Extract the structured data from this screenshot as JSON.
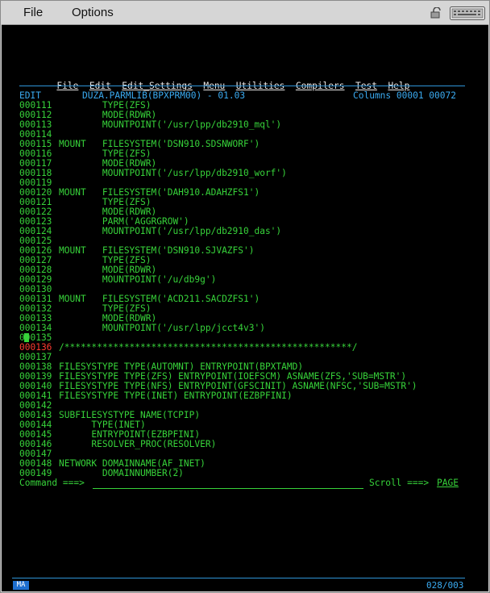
{
  "menubar": {
    "file": "File",
    "options": "Options"
  },
  "panel": {
    "menu": [
      "File",
      "Edit",
      "Edit_Settings",
      "Menu",
      "Utilities",
      "Compilers",
      "Test",
      "Help"
    ],
    "mode": "EDIT",
    "dataset": "DUZA.PARMLIB(BPXPRM00) - 01.03",
    "columns": "Columns 00001 00072"
  },
  "lines": [
    {
      "num": "000111",
      "cmd": "",
      "text": "        TYPE(ZFS)"
    },
    {
      "num": "000112",
      "cmd": "",
      "text": "        MODE(RDWR)"
    },
    {
      "num": "000113",
      "cmd": "",
      "text": "        MOUNTPOINT('/usr/lpp/db2910_mql')"
    },
    {
      "num": "000114",
      "cmd": "",
      "text": ""
    },
    {
      "num": "000115",
      "cmd": "",
      "text": "MOUNT   FILESYSTEM('DSN910.SDSNWORF')"
    },
    {
      "num": "000116",
      "cmd": "",
      "text": "        TYPE(ZFS)"
    },
    {
      "num": "000117",
      "cmd": "",
      "text": "        MODE(RDWR)"
    },
    {
      "num": "000118",
      "cmd": "",
      "text": "        MOUNTPOINT('/usr/lpp/db2910_worf')"
    },
    {
      "num": "000119",
      "cmd": "",
      "text": ""
    },
    {
      "num": "000120",
      "cmd": "",
      "text": "MOUNT   FILESYSTEM('DAH910.ADAHZFS1')"
    },
    {
      "num": "000121",
      "cmd": "",
      "text": "        TYPE(ZFS)"
    },
    {
      "num": "000122",
      "cmd": "",
      "text": "        MODE(RDWR)"
    },
    {
      "num": "000123",
      "cmd": "",
      "text": "        PARM('AGGRGROW')"
    },
    {
      "num": "000124",
      "cmd": "",
      "text": "        MOUNTPOINT('/usr/lpp/db2910_das')"
    },
    {
      "num": "000125",
      "cmd": "",
      "text": ""
    },
    {
      "num": "000126",
      "cmd": "",
      "text": "MOUNT   FILESYSTEM('DSN910.SJVAZFS')"
    },
    {
      "num": "000127",
      "cmd": "",
      "text": "        TYPE(ZFS)"
    },
    {
      "num": "000128",
      "cmd": "",
      "text": "        MODE(RDWR)"
    },
    {
      "num": "000129",
      "cmd": "",
      "text": "        MOUNTPOINT('/u/db9g')"
    },
    {
      "num": "000130",
      "cmd": "",
      "text": ""
    },
    {
      "num": "000131",
      "cmd": "",
      "text": "MOUNT   FILESYSTEM('ACD211.SACDZFS1')"
    },
    {
      "num": "000132",
      "cmd": "",
      "text": "        TYPE(ZFS)"
    },
    {
      "num": "000133",
      "cmd": "",
      "text": "        MODE(RDWR)"
    },
    {
      "num": "000134",
      "cmd": "",
      "text": "        MOUNTPOINT('/usr/lpp/jcct4v3')"
    },
    {
      "num": "000135",
      "cmd": "R",
      "text": ""
    },
    {
      "num": "000136",
      "cmd": "",
      "text": "/*****************************************************/"
    },
    {
      "num": "000137",
      "cmd": "",
      "text": ""
    },
    {
      "num": "000138",
      "cmd": "",
      "text": "FILESYSTYPE TYPE(AUTOMNT) ENTRYPOINT(BPXTAMD)"
    },
    {
      "num": "000139",
      "cmd": "",
      "text": "FILESYSTYPE TYPE(ZFS) ENTRYPOINT(IOEFSCM) ASNAME(ZFS,'SUB=MSTR')"
    },
    {
      "num": "000140",
      "cmd": "",
      "text": "FILESYSTYPE TYPE(NFS) ENTRYPOINT(GFSCINIT) ASNAME(NFSC,'SUB=MSTR')"
    },
    {
      "num": "000141",
      "cmd": "",
      "text": "FILESYSTYPE TYPE(INET) ENTRYPOINT(EZBPFINI)"
    },
    {
      "num": "000142",
      "cmd": "",
      "text": ""
    },
    {
      "num": "000143",
      "cmd": "",
      "text": "SUBFILESYSTYPE NAME(TCPIP)"
    },
    {
      "num": "000144",
      "cmd": "",
      "text": "      TYPE(INET)"
    },
    {
      "num": "000145",
      "cmd": "",
      "text": "      ENTRYPOINT(EZBPFINI)"
    },
    {
      "num": "000146",
      "cmd": "",
      "text": "      RESOLVER_PROC(RESOLVER)"
    },
    {
      "num": "000147",
      "cmd": "",
      "text": ""
    },
    {
      "num": "000148",
      "cmd": "",
      "text": "NETWORK DOMAINNAME(AF_INET)"
    },
    {
      "num": "000149",
      "cmd": "",
      "text": "        DOMAINNUMBER(2)"
    }
  ],
  "command": {
    "label": "Command ===>",
    "value": "",
    "scroll_label": "Scroll ===>",
    "scroll_value": "PAGE"
  },
  "status": {
    "indicator": "MA",
    "cursor_position": "028/003"
  },
  "colors": {
    "line_number": "#37d33a",
    "command_text": "#37d33a",
    "highlight_line": "#ff3b30",
    "separator": "#2f95d8",
    "header": "#3aaaf0"
  },
  "icons": [
    "lock-icon",
    "keyboard-icon"
  ]
}
